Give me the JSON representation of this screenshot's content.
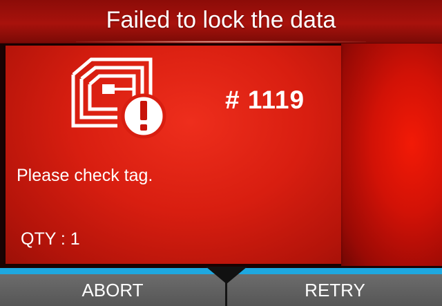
{
  "header": {
    "title": "Failed to lock the data"
  },
  "error": {
    "icon": "rfid-tag-error-icon",
    "code": "# 1119",
    "message": "Please check tag.",
    "qty": "QTY : 1"
  },
  "softkeys": {
    "left_label": "ABORT",
    "right_label": "RETRY"
  },
  "colors": {
    "background_red": "#d81e10",
    "accent_line": "#1ea8e0",
    "softkey_gray": "#5e5e5e"
  }
}
